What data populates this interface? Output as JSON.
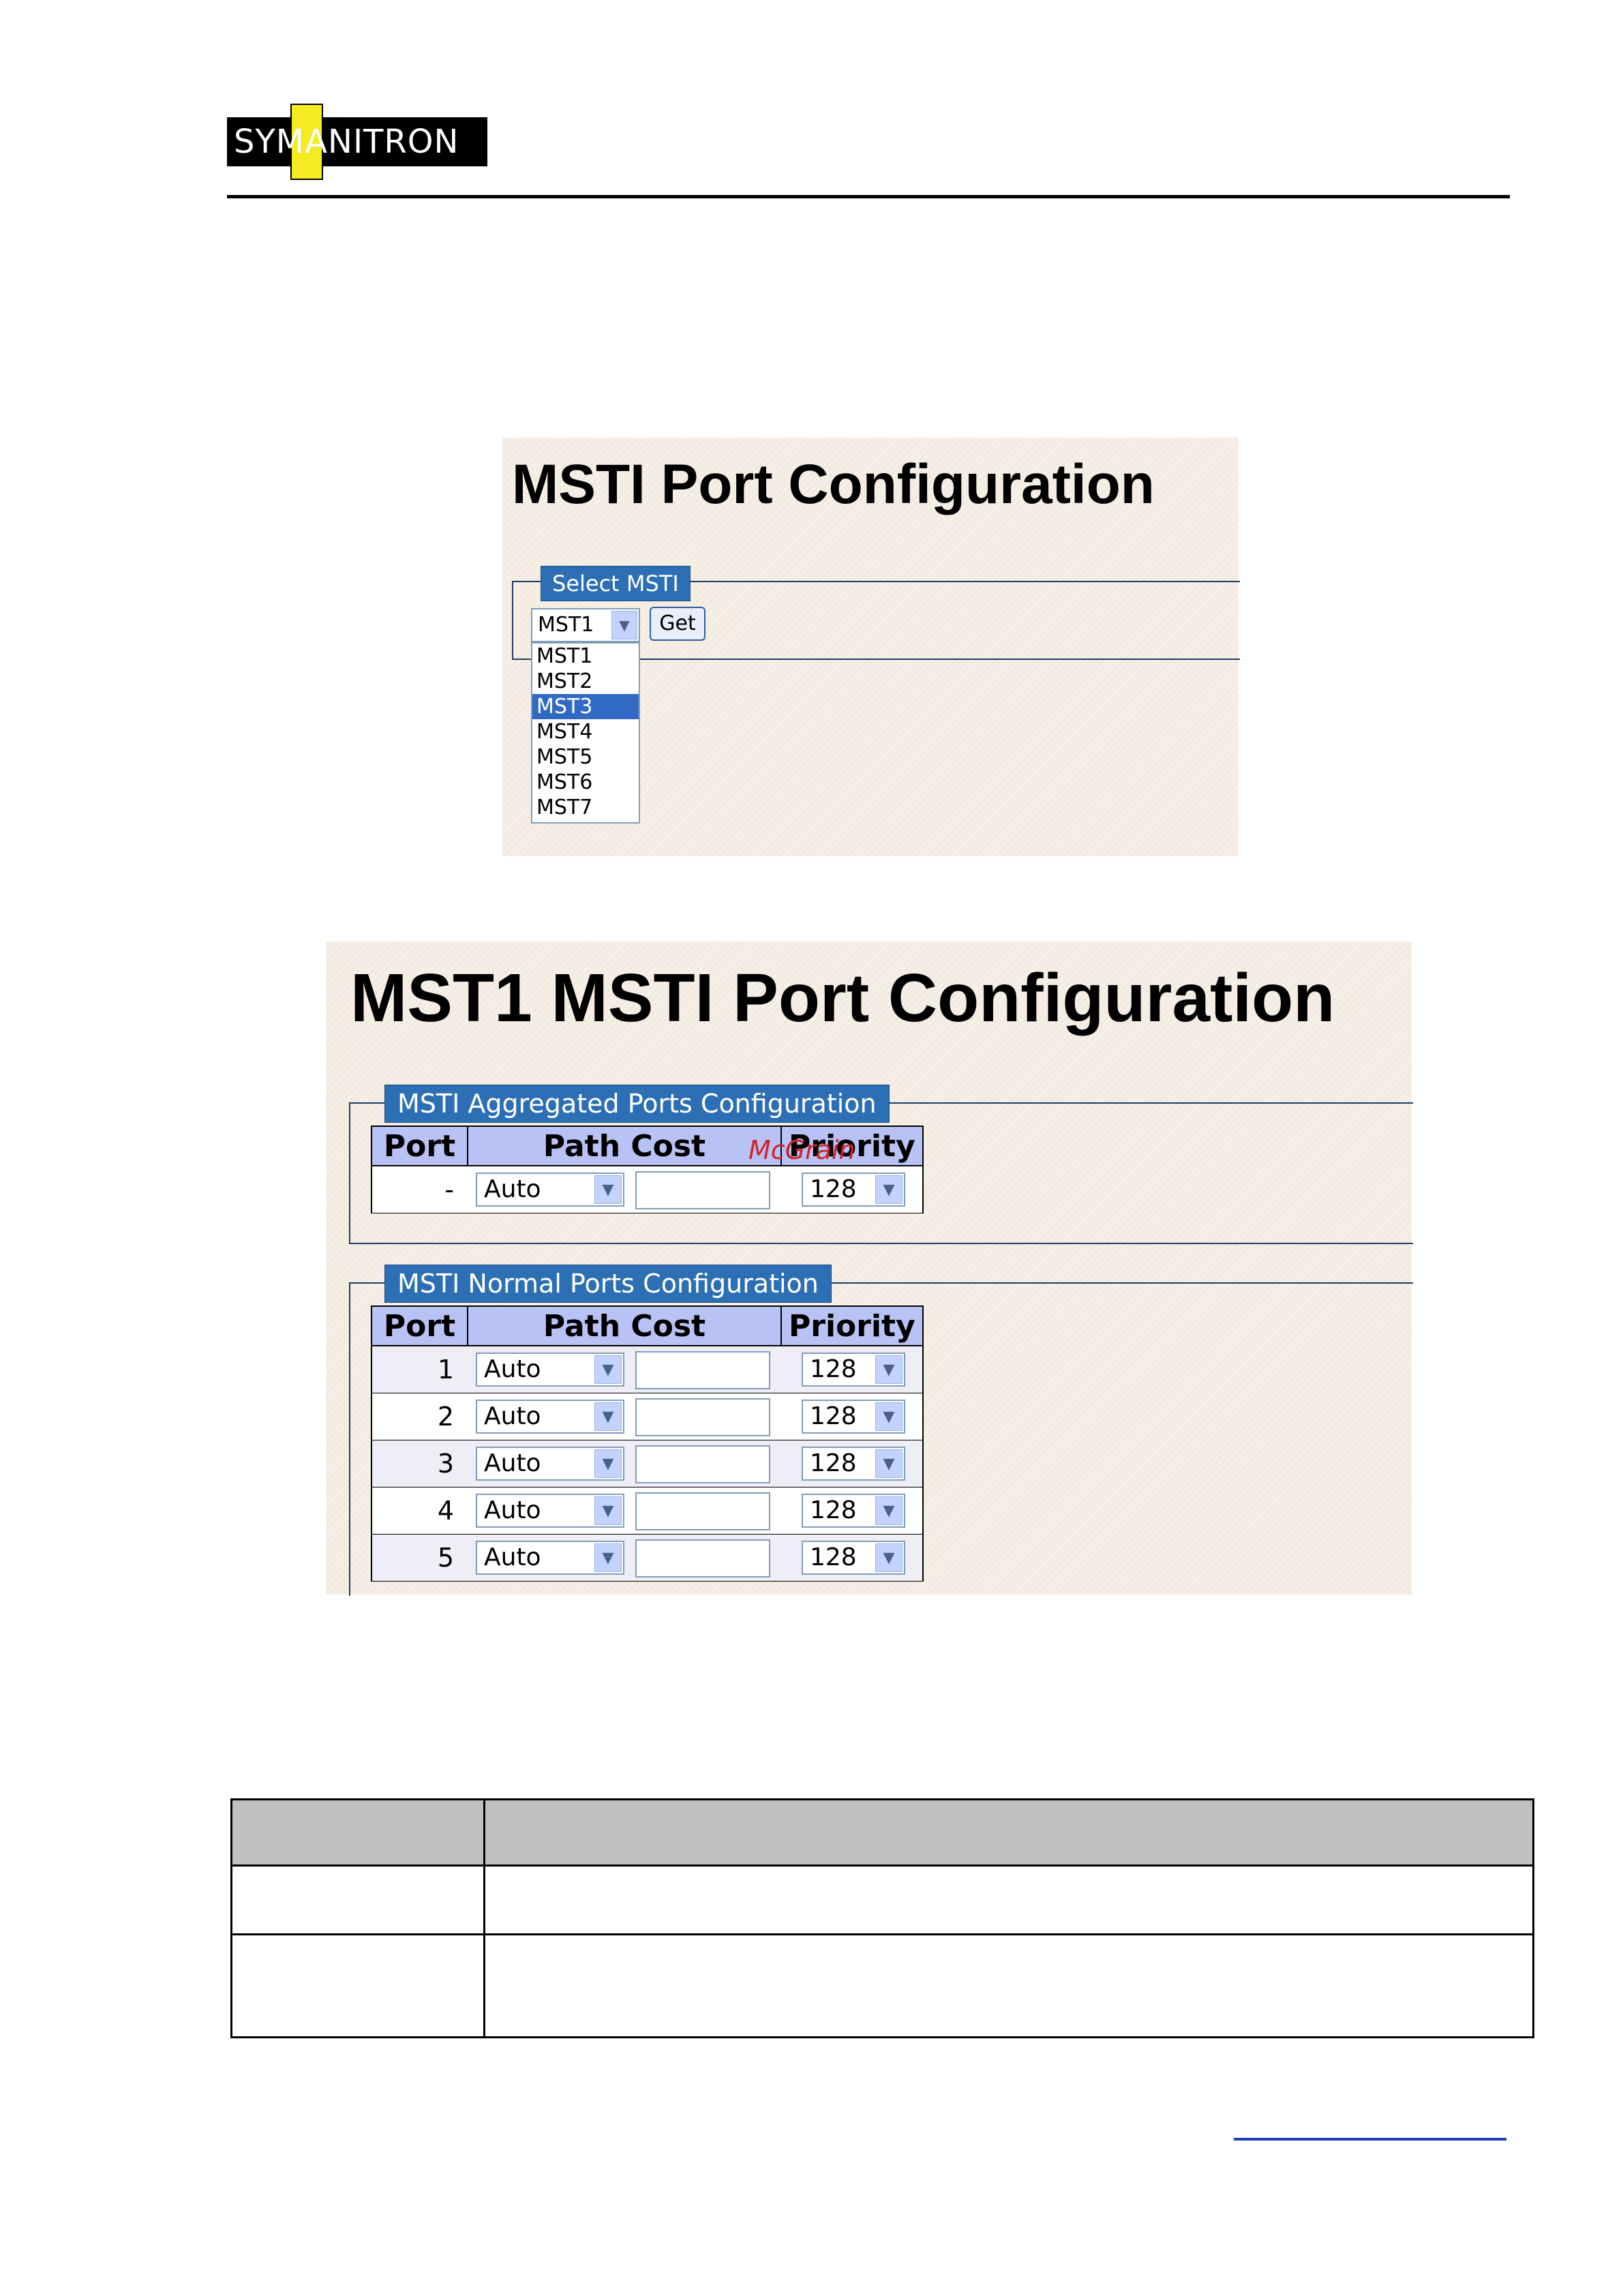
{
  "header": {
    "logo_text": "SYMANITRON"
  },
  "panel1": {
    "title": "MSTI Port Configuration",
    "legend": "Select MSTI",
    "select_value": "MST1",
    "get_label": "Get",
    "options": [
      "MST1",
      "MST2",
      "MST3",
      "MST4",
      "MST5",
      "MST6",
      "MST7"
    ],
    "highlighted": "MST3"
  },
  "panel2": {
    "title": "MST1 MSTI Port Configuration",
    "aggregated": {
      "legend": "MSTI Aggregated Ports Configuration",
      "headers": {
        "port": "Port",
        "path_cost": "Path Cost",
        "priority": "Priority"
      },
      "rows": [
        {
          "port": "-",
          "path_cost": "Auto",
          "priority": "128"
        }
      ]
    },
    "normal": {
      "legend": "MSTI Normal Ports Configuration",
      "headers": {
        "port": "Port",
        "path_cost": "Path Cost",
        "priority": "Priority"
      },
      "rows": [
        {
          "port": "1",
          "path_cost": "Auto",
          "priority": "128"
        },
        {
          "port": "2",
          "path_cost": "Auto",
          "priority": "128"
        },
        {
          "port": "3",
          "path_cost": "Auto",
          "priority": "128"
        },
        {
          "port": "4",
          "path_cost": "Auto",
          "priority": "128"
        },
        {
          "port": "5",
          "path_cost": "Auto",
          "priority": "128"
        }
      ]
    },
    "watermark": "McGrain"
  },
  "colors": {
    "legend_bg": "#2d6fb4",
    "header_bg": "#b8c2f4",
    "highlight": "#316ac5",
    "logo_yellow": "#f6ea21"
  }
}
